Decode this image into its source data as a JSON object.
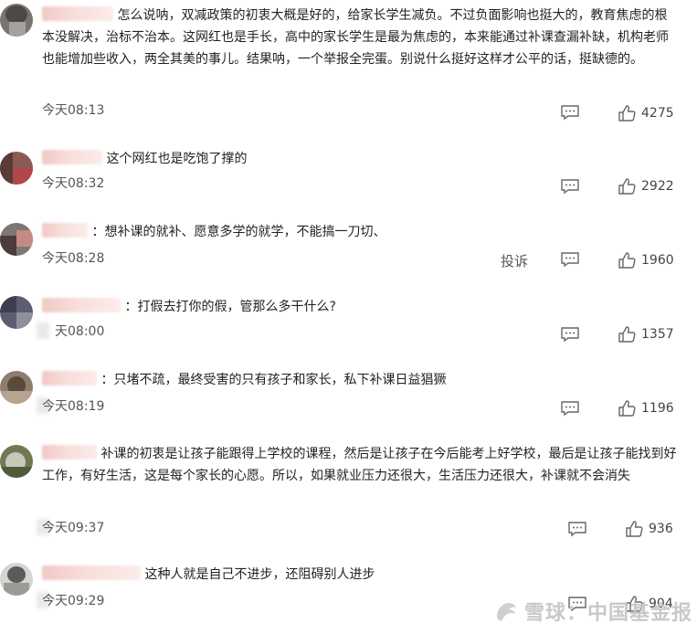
{
  "comments": [
    {
      "text": "怎么说呐，双减政策的初衷大概是好的，给家长学生减负。不过负面影响也挺大的，教育焦虑的根本没解决，治标不治本。这网红也是手长，高中的家长学生是最为焦虑的，本来能通过补课查漏补缺，机构老师也能增加些收入，两全其美的事儿。结果呐，一个举报全完蛋。别说什么挺好这样才公平的话，挺缺德的。",
      "time": "今天08:13",
      "likes": "4275"
    },
    {
      "text": "这个网红也是吃饱了撑的",
      "time": "今天08:32",
      "likes": "2922"
    },
    {
      "text": "：想补课的就补、愿意多学的就学，不能搞一刀切、",
      "time": "今天08:28",
      "report": "投诉",
      "likes": "1960"
    },
    {
      "text": "：打假去打你的假，管那么多干什么?",
      "time": "天08:00",
      "likes": "1357"
    },
    {
      "text": "：只堵不疏，最终受害的只有孩子和家长，私下补课日益猖獗",
      "time": "今天08:19",
      "likes": "1196"
    },
    {
      "text": "补课的初衷是让孩子能跟得上学校的课程，然后是让孩子在今后能考上好学校，最后是让孩子能找到好工作，有好生活，这是每个家长的心愿。所以，如果就业压力还很大，生活压力还很大，补课就不会消失",
      "time": "今天09:37",
      "likes": "936"
    },
    {
      "text": "这种人就是自己不进步，还阻碍别人进步",
      "time": "今天09:29",
      "likes": "904"
    }
  ],
  "watermark": "雪球：中国基金报",
  "colors": {
    "blur_name": "#f2c8c4",
    "text": "#222222",
    "meta": "#555555"
  }
}
